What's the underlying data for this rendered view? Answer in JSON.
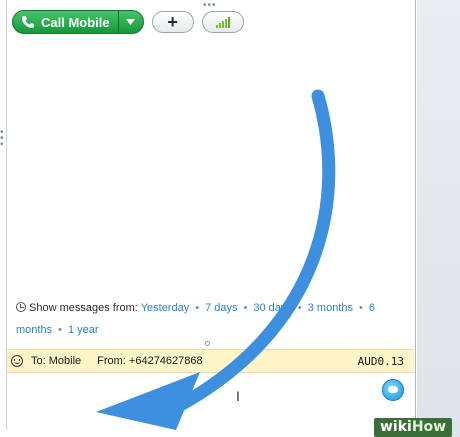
{
  "toolbar": {
    "call_label": "Call Mobile",
    "plus_label": "+"
  },
  "history": {
    "prefix": "Show messages from:",
    "links": [
      "Yesterday",
      "7 days",
      "30 days",
      "3 months",
      "6 months",
      "1 year"
    ]
  },
  "status_bar": {
    "to": "To: Mobile",
    "from": "From: +64274627868",
    "credit": "AUD0.13"
  },
  "watermark": {
    "wiki": "wiki",
    "how": "How"
  },
  "colors": {
    "call_green": "#17973c",
    "link_blue": "#2a80c7",
    "arrow_blue": "#3d8fe0",
    "status_yellow": "#fff5c8"
  },
  "icons": [
    "phone-icon",
    "chevron-down-icon",
    "plus-icon",
    "signal-icon",
    "clock-icon",
    "smiley-icon",
    "emoticon-icon",
    "text-cursor-icon"
  ]
}
